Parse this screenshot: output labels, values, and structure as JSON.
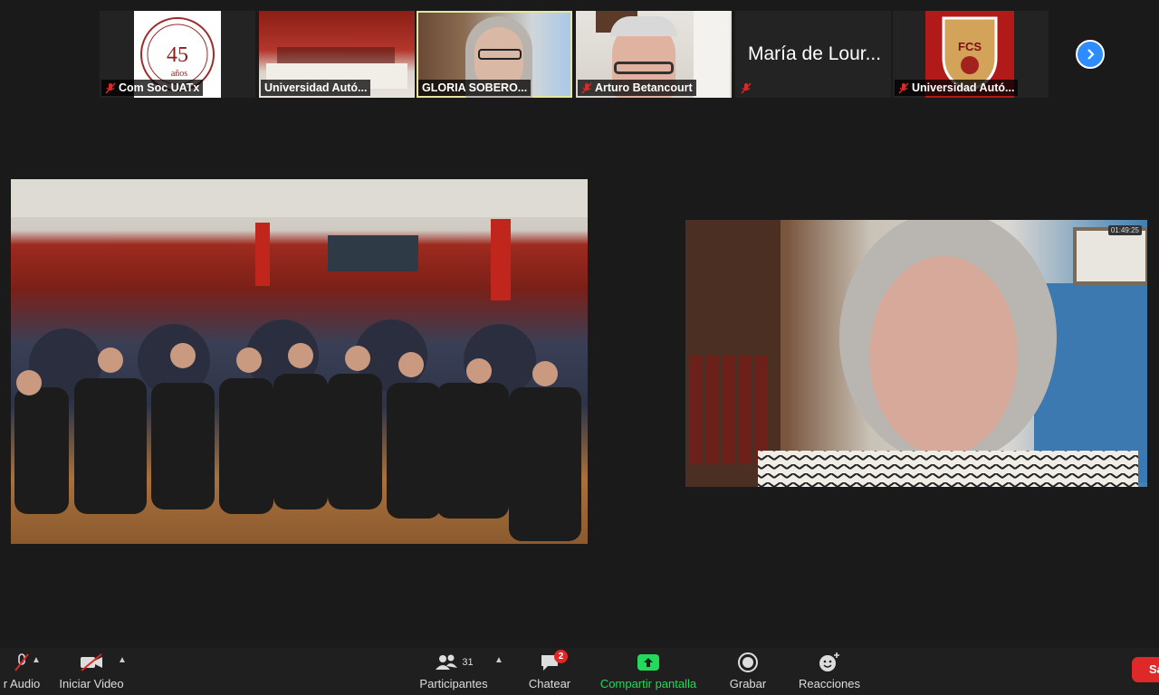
{
  "gallery": {
    "tiles": [
      {
        "name": "Com Soc UATx",
        "logo_text": "45",
        "logo_sub": "años"
      },
      {
        "name": "Universidad Autó..."
      },
      {
        "name": "GLORIA SOBERO..."
      },
      {
        "name": "Arturo Betancourt"
      },
      {
        "name": "",
        "big_name": "María de Lour..."
      },
      {
        "name": "Universidad Autó...",
        "logo_text": "FCS"
      }
    ]
  },
  "speaker_video": {
    "timer": "01:49:25"
  },
  "toolbar": {
    "audio_label": "r Audio",
    "video_label": "Iniciar Video",
    "participants_label": "Participantes",
    "participants_count": "31",
    "chat_label": "Chatear",
    "chat_badge": "2",
    "share_label": "Compartir pantalla",
    "record_label": "Grabar",
    "reactions_label": "Reacciones",
    "end_label": "Sa"
  },
  "colors": {
    "accent": "#2d8cff",
    "share": "#23d959",
    "danger": "#e02828"
  }
}
